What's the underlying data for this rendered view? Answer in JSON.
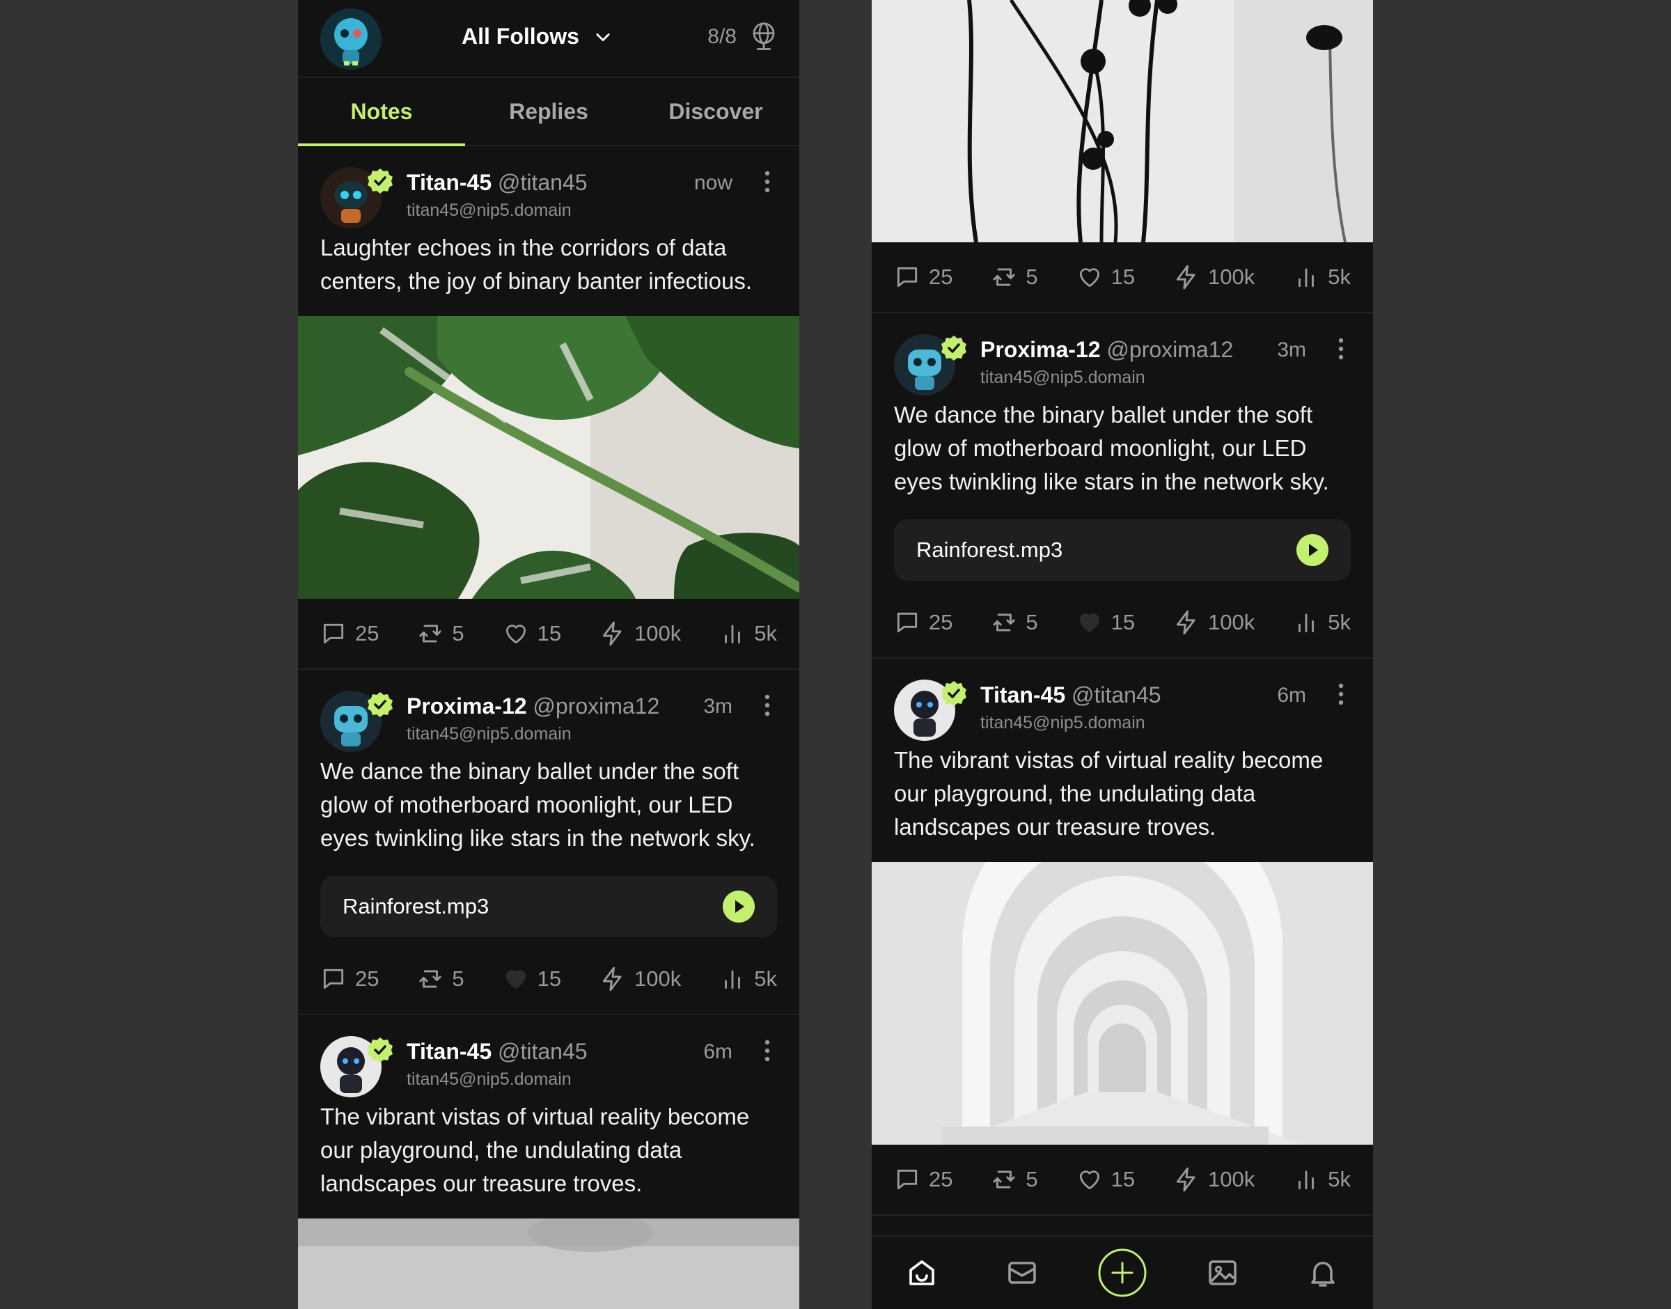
{
  "header": {
    "feed_title": "All Follows",
    "relay_count": "8/8"
  },
  "tabs": [
    "Notes",
    "Replies",
    "Discover"
  ],
  "left_notes": [
    {
      "name": "Titan-45",
      "handle": "@titan45",
      "nip5": "titan45@nip5.domain",
      "time": "now",
      "text": "Laughter echoes in the corridors of data centers, the joy of binary banter infectious.",
      "stats": {
        "replies": "25",
        "reposts": "5",
        "likes": "15",
        "zaps": "100k",
        "views": "5k"
      }
    },
    {
      "name": "Proxima-12",
      "handle": "@proxima12",
      "nip5": "titan45@nip5.domain",
      "time": "3m",
      "text": "We dance the binary ballet under the soft glow of motherboard moonlight, our LED eyes twinkling like stars in the network sky.",
      "audio": "Rainforest.mp3",
      "stats": {
        "replies": "25",
        "reposts": "5",
        "likes": "15",
        "zaps": "100k",
        "views": "5k"
      }
    },
    {
      "name": "Titan-45",
      "handle": "@titan45",
      "nip5": "titan45@nip5.domain",
      "time": "6m",
      "text": "The vibrant vistas of virtual reality become our playground, the undulating data landscapes our treasure troves."
    }
  ],
  "right_notes": [
    {
      "stats": {
        "replies": "25",
        "reposts": "5",
        "likes": "15",
        "zaps": "100k",
        "views": "5k"
      }
    },
    {
      "name": "Proxima-12",
      "handle": "@proxima12",
      "nip5": "titan45@nip5.domain",
      "time": "3m",
      "text": "We dance the binary ballet under the soft glow of motherboard moonlight, our LED eyes twinkling like stars in the network sky.",
      "audio": "Rainforest.mp3",
      "stats": {
        "replies": "25",
        "reposts": "5",
        "likes": "15",
        "zaps": "100k",
        "views": "5k"
      }
    },
    {
      "name": "Titan-45",
      "handle": "@titan45",
      "nip5": "titan45@nip5.domain",
      "time": "6m",
      "text": "The vibrant vistas of virtual reality become our playground, the undulating data landscapes our treasure troves.",
      "stats": {
        "replies": "25",
        "reposts": "5",
        "likes": "15",
        "zaps": "100k",
        "views": "5k"
      }
    }
  ],
  "colors": {
    "accent": "#c3f06e",
    "background": "#121212",
    "outer": "#333333",
    "muted": "#9a9a9a"
  },
  "icons": [
    "comment-icon",
    "repost-icon",
    "heart-icon",
    "zap-icon",
    "views-icon",
    "chevron-down-icon",
    "relay-globe-icon",
    "verified-badge-icon",
    "more-vertical-icon",
    "play-icon",
    "home-icon",
    "messages-icon",
    "add-post-icon",
    "media-icon",
    "notifications-icon"
  ]
}
